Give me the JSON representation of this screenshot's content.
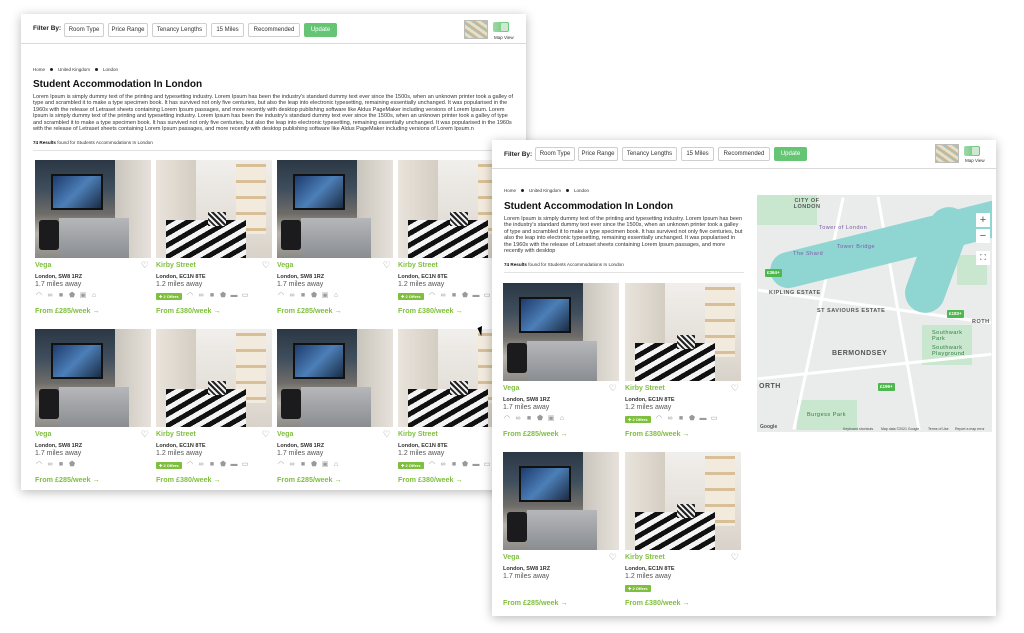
{
  "filter": {
    "label": "Filter By:",
    "chips": [
      "Room Type",
      "Price Range",
      "Tenancy Lengths",
      "15 Miles",
      "Recommended"
    ],
    "update": "Update",
    "map_view": "Map View"
  },
  "breadcrumb": [
    "Home",
    "United Kingdom",
    "London"
  ],
  "page_title": "Student Accommodation In London",
  "description_wide": "Lorem Ipsum is simply dummy text of the printing and typesetting industry. Lorem Ipsum has been the industry's standard dummy text ever since the 1500s, when an unknown printer took a galley of type and scrambled it to make a type specimen book. It has survived not only five centuries, but also the leap into electronic typesetting, remaining essentially unchanged. It was popularised in the 1960s with the release of Letraset sheets containing Lorem Ipsum passages, and more recently with desktop publishing software like Aldus PageMaker including versions of Lorem Ipsum. Lorem Ipsum is simply dummy text of the printing and typesetting industry. Lorem Ipsum has been the industry's standard dummy text ever since the 1500s, when an unknown printer took a galley of type and scrambled it to make a type specimen book. It has survived not only five centuries, but also the leap into electronic typesetting, remaining essentially unchanged. It was popularised in the 1960s with the release of Letraset sheets containing Lorem Ipsum passages, and more recently with desktop publishing software like Aldus PageMaker including versions of Lorem Ipsum.n",
  "description_narrow": "Lorem Ipsum is simply dummy text of the printing and typesetting industry. Lorem Ipsum has been the industry's standard dummy text ever since the 1500s, when an unknown printer took a galley of type and scrambled it to make a type specimen book. It has survived not only five centuries, but also the leap into electronic typesetting, remaining essentially unchanged. It was popularised in the 1960s with the release of Letraset sheets containing Lorem Ipsum passages, and more recently with desktop",
  "results": {
    "count": "74 Results",
    "suffix": "found for Students Accommodations In London"
  },
  "cards": {
    "vega": {
      "name": "Vega",
      "address": "London, SW8 1RZ",
      "distance": "1.7 miles away",
      "price": "From £285/week →"
    },
    "kirby": {
      "name": "Kirby Street",
      "address": "London, EC1N 8TE",
      "distance": "1.2 miles away",
      "offers": "✚ 2 Offers",
      "price": "From £380/week →"
    }
  },
  "map": {
    "labels": [
      "CITY OF LONDON",
      "Tower of London",
      "Tower Bridge",
      "The Shard",
      "KIPLING ESTATE",
      "ST SAVIOURS ESTATE",
      "BERMONDSEY",
      "Southwark Park",
      "Southwark Playground",
      "Burgess Park",
      "ROTH",
      "ORTH"
    ],
    "pins": [
      "£364+",
      "£183+",
      "£199+"
    ],
    "attribution": [
      "Keyboard shortcuts",
      "Map data ©2021 Google",
      "Terms of Use",
      "Report a map error"
    ],
    "google": "Google"
  },
  "icons": [
    "wifi-icon",
    "bike-icon",
    "cctv-icon",
    "shield-icon",
    "laundry-icon",
    "study-icon",
    "gym-icon"
  ]
}
